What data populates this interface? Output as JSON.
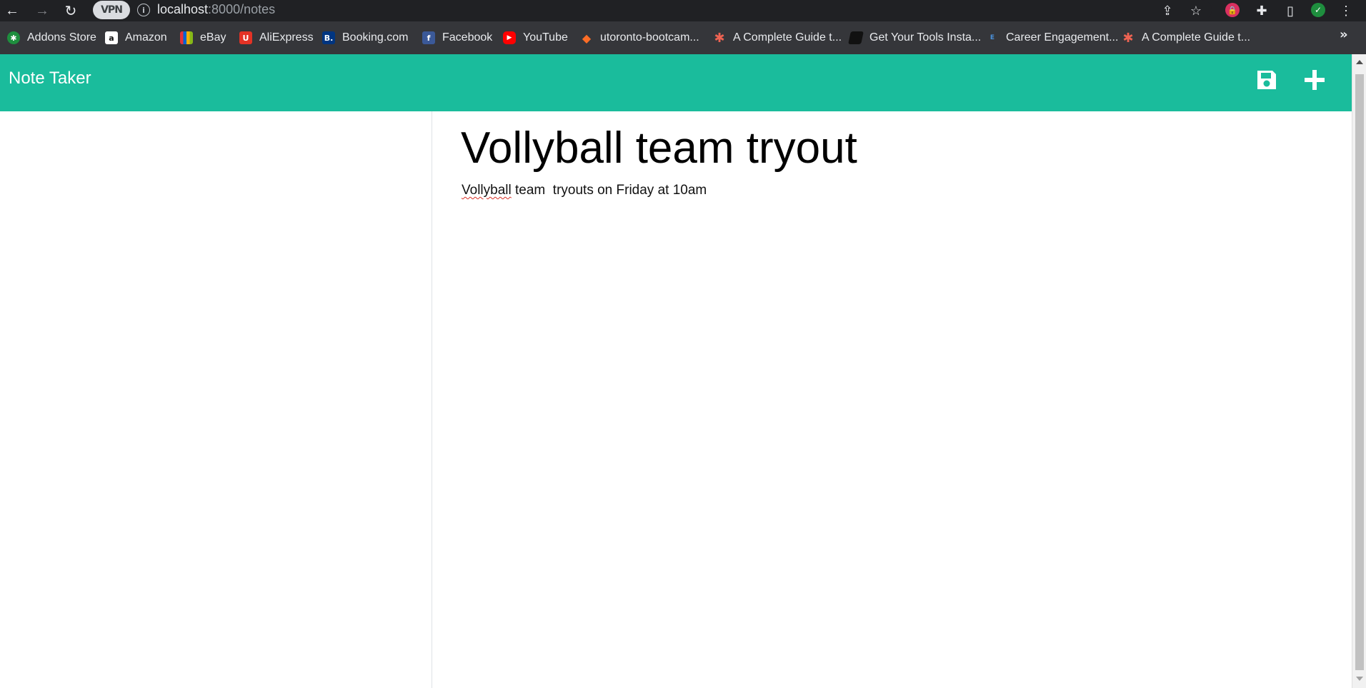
{
  "browser": {
    "url_host": "localhost",
    "url_path": ":8000/notes",
    "vpn_label": "VPN",
    "bookmarks": [
      {
        "label": "Addons Store",
        "icon": "addons-store-icon",
        "color": "#1e8e3e",
        "glyph": "✱"
      },
      {
        "label": "Amazon",
        "icon": "amazon-icon",
        "color": "#ffffff",
        "glyph": "a"
      },
      {
        "label": "eBay",
        "icon": "ebay-icon",
        "color": "#5b5b5b",
        "glyph": "▤"
      },
      {
        "label": "AliExpress",
        "icon": "aliexpress-icon",
        "color": "#e43225",
        "glyph": "U"
      },
      {
        "label": "Booking.com",
        "icon": "booking-icon",
        "color": "#003580",
        "glyph": "B."
      },
      {
        "label": "Facebook",
        "icon": "facebook-icon",
        "color": "#3b5998",
        "glyph": "f"
      },
      {
        "label": "YouTube",
        "icon": "youtube-icon",
        "color": "#ff0000",
        "glyph": "▶"
      },
      {
        "label": "utoronto-bootcam...",
        "icon": "gitlab-icon",
        "color": "#fc6d26",
        "glyph": "◆"
      },
      {
        "label": "A Complete Guide t...",
        "icon": "asterisk-icon",
        "color": "#35363a",
        "glyph": "✱"
      },
      {
        "label": "Get Your Tools Insta...",
        "icon": "book-icon",
        "color": "#111111",
        "glyph": "▮"
      },
      {
        "label": "Career Engagement...",
        "icon": "career-icon",
        "color": "#35363a",
        "glyph": "E"
      },
      {
        "label": "A Complete Guide t...",
        "icon": "asterisk-icon",
        "color": "#35363a",
        "glyph": "✱"
      }
    ],
    "more_label": "»"
  },
  "app": {
    "brand": "Note Taker",
    "accent": "#1abc9c"
  },
  "note": {
    "title": "Vollyball team tryout",
    "text_misspelled": "Vollyball",
    "text_rest": " team  tryouts on Friday at 10am"
  }
}
